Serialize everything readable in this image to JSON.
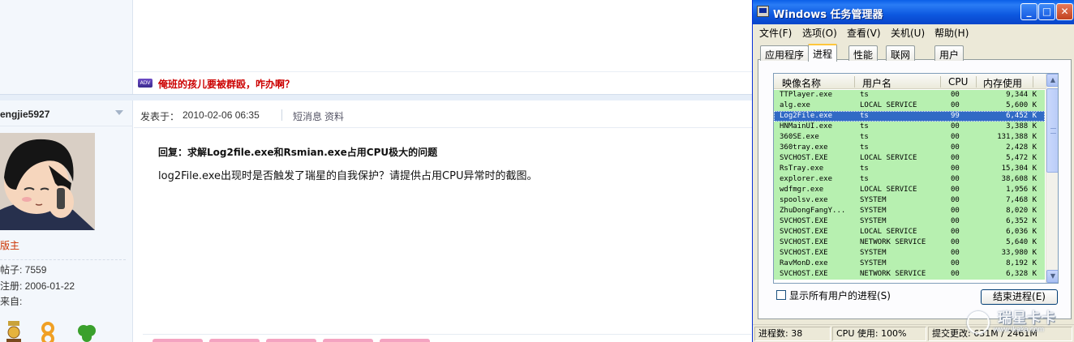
{
  "forum": {
    "ad_badge": "ADV",
    "ad_text": "俺班的孩儿要被群殴，咋办啊？",
    "username": "engjie5927",
    "rank": "版主",
    "stats": [
      "帖子: 7559",
      "注册:  2006-01-22",
      "来自:"
    ],
    "post_label": "发表于：",
    "post_date": "2010-02-06 06:35",
    "link_message": "短消息",
    "link_profile": "资料",
    "post_title": "回复：求解Log2file.exe和Rsmian.exe占用CPU极大的问题",
    "post_body": "log2File.exe出现时是否触发了瑞星的自我保护？请提供占用CPU异常时的截图。"
  },
  "taskmgr": {
    "title": "Windows 任务管理器",
    "controls": [
      "minimize-icon",
      "maximize-icon",
      "close-icon"
    ],
    "menu": [
      "文件(F)",
      "选项(O)",
      "查看(V)",
      "关机(U)",
      "帮助(H)"
    ],
    "tabs": [
      "应用程序",
      "进程",
      "性能",
      "联网",
      "用户"
    ],
    "active_tab": "进程",
    "columns": [
      "映像名称",
      "用户名",
      "CPU",
      "内存使用"
    ],
    "rows": [
      {
        "name": "TTPlayer.exe",
        "user": "ts",
        "cpu": "00",
        "mem": "9,344 K"
      },
      {
        "name": "alg.exe",
        "user": "LOCAL SERVICE",
        "cpu": "00",
        "mem": "5,600 K"
      },
      {
        "name": "Log2File.exe",
        "user": "ts",
        "cpu": "99",
        "mem": "6,452 K"
      },
      {
        "name": "HNMainUI.exe",
        "user": "ts",
        "cpu": "00",
        "mem": "3,388 K"
      },
      {
        "name": "360SE.exe",
        "user": "ts",
        "cpu": "00",
        "mem": "131,388 K"
      },
      {
        "name": "360tray.exe",
        "user": "ts",
        "cpu": "00",
        "mem": "2,428 K"
      },
      {
        "name": "SVCHOST.EXE",
        "user": "LOCAL SERVICE",
        "cpu": "00",
        "mem": "5,472 K"
      },
      {
        "name": "RsTray.exe",
        "user": "ts",
        "cpu": "00",
        "mem": "15,304 K"
      },
      {
        "name": "explorer.exe",
        "user": "ts",
        "cpu": "00",
        "mem": "38,608 K"
      },
      {
        "name": "wdfmgr.exe",
        "user": "LOCAL SERVICE",
        "cpu": "00",
        "mem": "1,956 K"
      },
      {
        "name": "spoolsv.exe",
        "user": "SYSTEM",
        "cpu": "00",
        "mem": "7,468 K"
      },
      {
        "name": "ZhuDongFangY...",
        "user": "SYSTEM",
        "cpu": "00",
        "mem": "8,020 K"
      },
      {
        "name": "SVCHOST.EXE",
        "user": "SYSTEM",
        "cpu": "00",
        "mem": "6,352 K"
      },
      {
        "name": "SVCHOST.EXE",
        "user": "LOCAL SERVICE",
        "cpu": "00",
        "mem": "6,036 K"
      },
      {
        "name": "SVCHOST.EXE",
        "user": "NETWORK SERVICE",
        "cpu": "00",
        "mem": "5,640 K"
      },
      {
        "name": "SVCHOST.EXE",
        "user": "SYSTEM",
        "cpu": "00",
        "mem": "33,980 K"
      },
      {
        "name": "RavMonD.exe",
        "user": "SYSTEM",
        "cpu": "00",
        "mem": "8,192 K"
      },
      {
        "name": "SVCHOST.EXE",
        "user": "NETWORK SERVICE",
        "cpu": "00",
        "mem": "6,328 K"
      }
    ],
    "selected_row": 2,
    "show_all_label": "显示所有用户的进程(S)",
    "end_process_label": "结束进程(E)",
    "status": {
      "processes": "进程数: 38",
      "cpu": "CPU 使用: 100%",
      "commit": "提交更改: 631M / 2461M"
    }
  },
  "watermark": {
    "text": "瑞星卡卡",
    "url": "www.ikaka.com"
  },
  "colors": {
    "title_blue": "#0a5fe8",
    "row_green": "#b7f0b0",
    "selection": "#316ac5",
    "ad_red": "#cc0000",
    "rank_red": "#cc3300"
  }
}
